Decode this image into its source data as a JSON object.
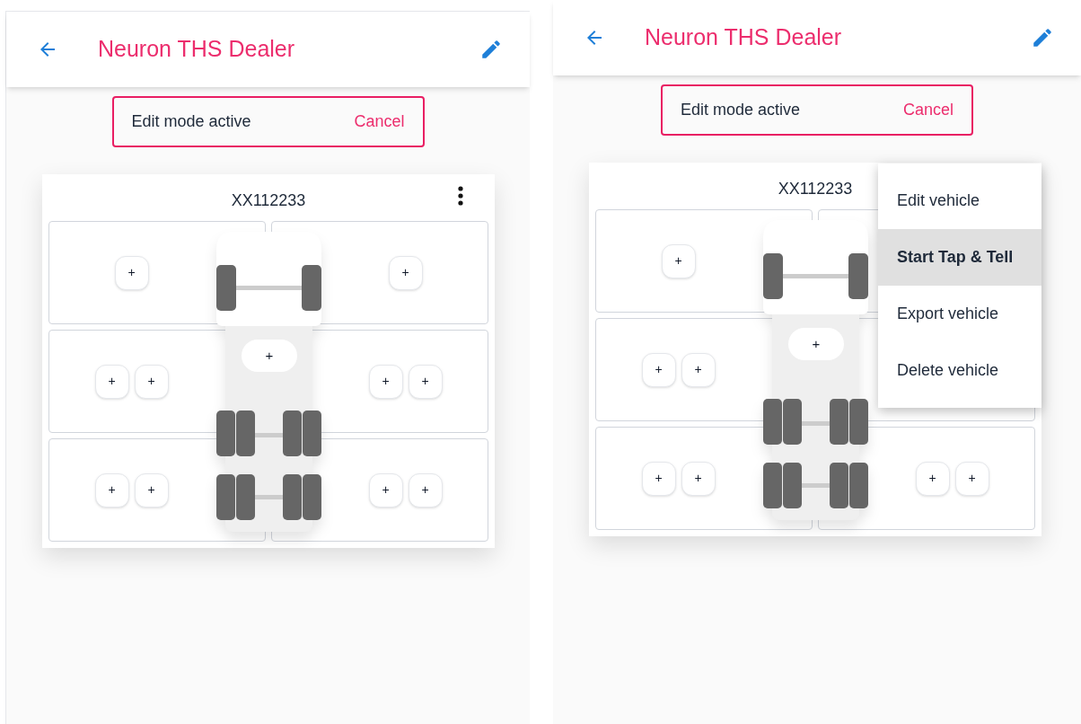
{
  "screens": [
    {
      "app_bar": {
        "title": "Neuron THS Dealer"
      },
      "edit_banner": {
        "label": "Edit mode active",
        "action": "Cancel"
      },
      "vehicle": {
        "plate": "XX112233",
        "menu_button": true,
        "center_button": "+",
        "rows": [
          {
            "left": [
              "+"
            ],
            "right": [
              "+"
            ]
          },
          {
            "left": [
              "+",
              "+"
            ],
            "right": [
              "+",
              "+"
            ]
          },
          {
            "left": [
              "+",
              "+"
            ],
            "right": [
              "+",
              "+"
            ]
          }
        ]
      }
    },
    {
      "app_bar": {
        "title": "Neuron THS Dealer"
      },
      "edit_banner": {
        "label": "Edit mode active",
        "action": "Cancel"
      },
      "vehicle": {
        "plate": "XX112233",
        "menu_button": false,
        "center_button": "+",
        "rows": [
          {
            "left": [
              "+"
            ]
          },
          {
            "left": [
              "+",
              "+"
            ]
          },
          {
            "left": [
              "+",
              "+"
            ],
            "right": [
              "+",
              "+"
            ]
          }
        ]
      },
      "menu": {
        "items": [
          {
            "label": "Edit vehicle",
            "selected": false
          },
          {
            "label": "Start Tap & Tell",
            "selected": true
          },
          {
            "label": "Export vehicle",
            "selected": false
          },
          {
            "label": "Delete vehicle",
            "selected": false
          }
        ]
      }
    }
  ]
}
